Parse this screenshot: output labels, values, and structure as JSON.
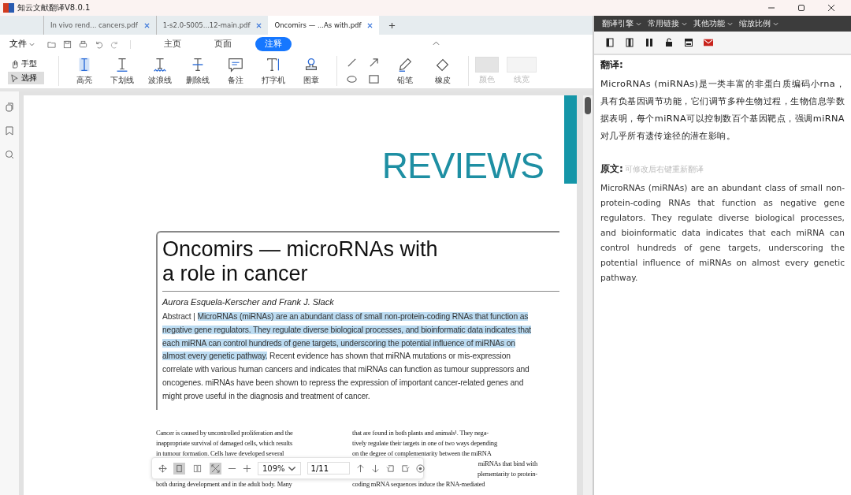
{
  "app": {
    "title": "知云文献翻译V8.0.1"
  },
  "tabs": [
    {
      "label": "In vivo rend... cancers.pdf",
      "selected": false
    },
    {
      "label": "1-s2.0-S005...12-main.pdf",
      "selected": false
    },
    {
      "label": "Oncomirs — ...As with.pdf",
      "selected": true
    }
  ],
  "file_menu": "文件",
  "ribbon_tabs": [
    {
      "label": "主页",
      "selected": false
    },
    {
      "label": "页面",
      "selected": false
    },
    {
      "label": "注释",
      "selected": true
    }
  ],
  "modes": [
    {
      "label": "手型",
      "kind": "hand",
      "selected": false
    },
    {
      "label": "选择",
      "kind": "select",
      "selected": true
    }
  ],
  "tools": [
    {
      "label": "高亮",
      "kind": "highlight"
    },
    {
      "label": "下划线",
      "kind": "underline"
    },
    {
      "label": "波浪线",
      "kind": "squiggly"
    },
    {
      "label": "删除线",
      "kind": "strike"
    },
    {
      "label": "备注",
      "kind": "note"
    },
    {
      "label": "打字机",
      "kind": "typewriter"
    },
    {
      "label": "图章",
      "kind": "stamp"
    }
  ],
  "draw_tools": [
    {
      "label": "铅笔",
      "kind": "pencil"
    },
    {
      "label": "橡皮",
      "kind": "eraser"
    }
  ],
  "style_controls": [
    {
      "label": "颜色",
      "kind": "color",
      "disabled": true
    },
    {
      "label": "线宽",
      "kind": "width",
      "disabled": true
    }
  ],
  "document": {
    "header": "REVIEWS",
    "title_lines": [
      "Oncomirs — microRNAs with",
      "a role in cancer"
    ],
    "authors": "Aurora Esquela-Kerscher and Frank J. Slack",
    "abstract": {
      "label": "Abstract |",
      "highlighted": "MicroRNAs (miRNAs) are an abundant class of small non-protein-coding RNAs that function as negative gene regulators. They regulate diverse biological processes, and bioinformatic data indicates that each miRNA can control hundreds of gene targets, underscoring the potential influence of miRNAs on almost every genetic pathway.",
      "rest": "Recent evidence has shown that miRNA mutations or mis-expression correlate with various human cancers and indicates that miRNAs can function as tumour suppressors and oncogenes. miRNAs have been shown to repress the expression of important cancer-related genes and might prove useful in the diagnosis and treatment of cancer."
    },
    "columns": [
      {
        "top": [
          "Cancer is caused by uncontrolled proliferation and the",
          "inappropriate survival of damaged cells, which results",
          "in tumour formation. Cells have developed several"
        ],
        "bottom": [
          "both during development and in the adult body. Many"
        ]
      },
      {
        "top": [
          "that are found in both plants and animals¹. They nega-",
          "tively regulate their targets in one of two ways depending",
          "on the degree of complementarity between the miRNA"
        ],
        "partial": [
          "miRNAs that bind with",
          "plementarity to protein-"
        ],
        "bottom": [
          "coding mRNA sequences induce the RNA-mediated"
        ]
      }
    ]
  },
  "viewer_toolbar": {
    "layouts": [
      {
        "kind": "single",
        "selected": true
      },
      {
        "kind": "double",
        "selected": false
      },
      {
        "kind": "fit",
        "selected": true
      }
    ],
    "zoom": "109%",
    "page": "1/11"
  },
  "side_panel": {
    "menus": [
      "翻译引擎",
      "常用链接",
      "其他功能",
      "缩放比例"
    ],
    "translation_heading": "翻译:",
    "translation": "MicroRNAs (miRNAs)是一类丰富的非蛋白质编码小rna，具有负基因调节功能，它们调节多种生物过程，生物信息学数据表明，每个miRNA可以控制数百个基因靶点，强调miRNA对几乎所有遗传途径的潜在影响。",
    "source_heading": "原文:",
    "source_placeholder": "可修改后右键重新翻译",
    "source": "MicroRNAs (miRNAs) are an abundant class of small non-protein-coding RNAs that function as negative gene regulators. They regulate diverse biological processes, and bioinformatic data indicates that each miRNA can control hundreds of gene targets, underscoring the potential influence of miRNAs on almost every genetic pathway."
  }
}
